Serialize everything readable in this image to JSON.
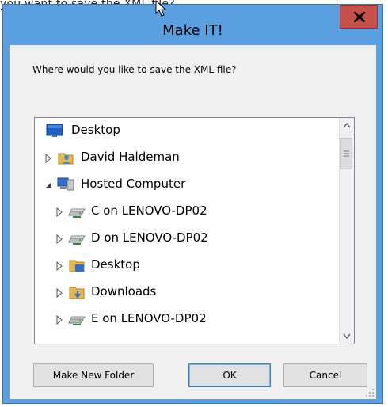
{
  "background_text": "you want to save the XML file? ...",
  "dialog": {
    "title": "Make IT!",
    "close_label": "x",
    "prompt": "Where would you like to save the XML file?"
  },
  "tree": {
    "items": [
      {
        "label": "Desktop",
        "icon": "desktop-icon",
        "expander": "none"
      },
      {
        "label": "David Haldeman",
        "icon": "user-folder-icon",
        "expander": "collapsed"
      },
      {
        "label": "Hosted Computer",
        "icon": "computer-icon",
        "expander": "expanded"
      },
      {
        "label": "C on LENOVO-DP02",
        "icon": "network-drive-icon",
        "expander": "collapsed"
      },
      {
        "label": "D on LENOVO-DP02",
        "icon": "network-drive-icon",
        "expander": "collapsed"
      },
      {
        "label": "Desktop",
        "icon": "folder-icon",
        "expander": "collapsed"
      },
      {
        "label": "Downloads",
        "icon": "downloads-folder-icon",
        "expander": "collapsed"
      },
      {
        "label": "E on LENOVO-DP02",
        "icon": "network-drive-icon",
        "expander": "collapsed"
      }
    ]
  },
  "buttons": {
    "new_folder": "Make New Folder",
    "ok": "OK",
    "cancel": "Cancel"
  },
  "colors": {
    "title_bar": "#5aa0e0",
    "close_button": "#c7504a",
    "client_bg": "#f0f0f0"
  }
}
